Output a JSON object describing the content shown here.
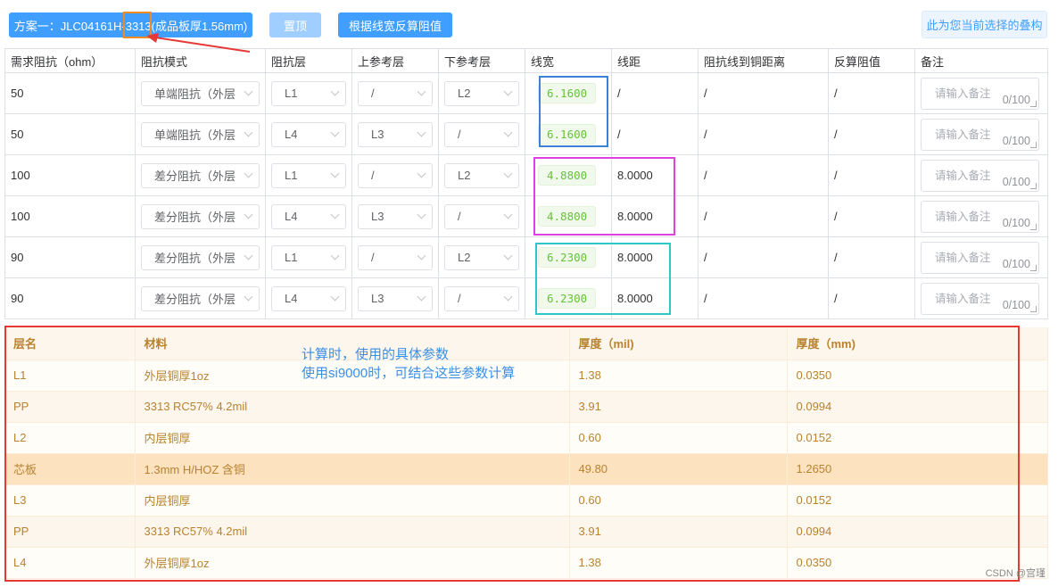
{
  "toolbar": {
    "scheme_label": "方案一：JLC04161H-3313(成品板厚1.56mm)",
    "pin_label": "置顶",
    "calc_label": "根据线宽反算阻值",
    "current_label": "此为您当前选择的叠构"
  },
  "impedance": {
    "headers": [
      "需求阻抗（ohm）",
      "阻抗模式",
      "阻抗层",
      "上参考层",
      "下参考层",
      "线宽",
      "线距",
      "阻抗线到铜距离",
      "反算阻值",
      "备注"
    ],
    "rows": [
      {
        "req": "50",
        "mode": "单端阻抗（外层",
        "layer": "L1",
        "upper": "/",
        "lower": "L2",
        "width": "6.1600",
        "space": "/",
        "dist": "/",
        "calc": "/",
        "note_ph": "请输入备注",
        "note_cnt": "0/100"
      },
      {
        "req": "50",
        "mode": "单端阻抗（外层",
        "layer": "L4",
        "upper": "L3",
        "lower": "/",
        "width": "6.1600",
        "space": "/",
        "dist": "/",
        "calc": "/",
        "note_ph": "请输入备注",
        "note_cnt": "0/100"
      },
      {
        "req": "100",
        "mode": "差分阻抗（外层",
        "layer": "L1",
        "upper": "/",
        "lower": "L2",
        "width": "4.8800",
        "space": "8.0000",
        "dist": "/",
        "calc": "/",
        "note_ph": "请输入备注",
        "note_cnt": "0/100"
      },
      {
        "req": "100",
        "mode": "差分阻抗（外层",
        "layer": "L4",
        "upper": "L3",
        "lower": "/",
        "width": "4.8800",
        "space": "8.0000",
        "dist": "/",
        "calc": "/",
        "note_ph": "请输入备注",
        "note_cnt": "0/100"
      },
      {
        "req": "90",
        "mode": "差分阻抗（外层",
        "layer": "L1",
        "upper": "/",
        "lower": "L2",
        "width": "6.2300",
        "space": "8.0000",
        "dist": "/",
        "calc": "/",
        "note_ph": "请输入备注",
        "note_cnt": "0/100"
      },
      {
        "req": "90",
        "mode": "差分阻抗（外层",
        "layer": "L4",
        "upper": "L3",
        "lower": "/",
        "width": "6.2300",
        "space": "8.0000",
        "dist": "/",
        "calc": "/",
        "note_ph": "请输入备注",
        "note_cnt": "0/100"
      }
    ]
  },
  "stack": {
    "headers": [
      "层名",
      "材料",
      "厚度（mil)",
      "厚度（mm)"
    ],
    "rows": [
      {
        "name": "L1",
        "material": "外层铜厚1oz",
        "mil": "1.38",
        "mm": "0.0350"
      },
      {
        "name": "PP",
        "material": "3313 RC57% 4.2mil",
        "mil": "3.91",
        "mm": "0.0994"
      },
      {
        "name": "L2",
        "material": "内层铜厚",
        "mil": "0.60",
        "mm": "0.0152"
      },
      {
        "name": "芯板",
        "material": "1.3mm H/HOZ 含铜",
        "mil": "49.80",
        "mm": "1.2650"
      },
      {
        "name": "L3",
        "material": "内层铜厚",
        "mil": "0.60",
        "mm": "0.0152"
      },
      {
        "name": "PP",
        "material": "3313 RC57% 4.2mil",
        "mil": "3.91",
        "mm": "0.0994"
      },
      {
        "name": "L4",
        "material": "外层铜厚1oz",
        "mil": "1.38",
        "mm": "0.0350"
      }
    ]
  },
  "annotation": {
    "line1": "计算时，使用的具体参数",
    "line2": "使用si9000时，可结合这些参数计算"
  },
  "watermark": "CSDN @宫瑾",
  "colors": {
    "primary": "#409eff",
    "blue_box": "#3b82d6",
    "magenta_box": "#e040e0",
    "cyan_box": "#2ec7c9",
    "red_box": "#e53935",
    "orange_box": "#f08a24"
  }
}
